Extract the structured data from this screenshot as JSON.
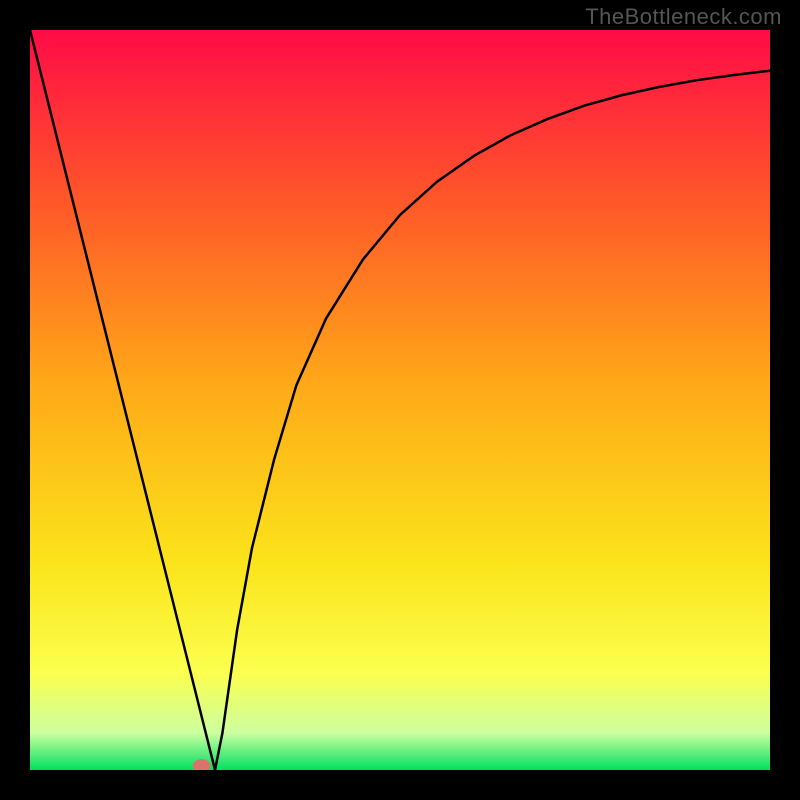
{
  "watermark": "TheBottleneck.com",
  "chart_data": {
    "type": "line",
    "title": "",
    "xlabel": "",
    "ylabel": "",
    "xlim": [
      0,
      100
    ],
    "ylim": [
      0,
      100
    ],
    "grid": false,
    "legend": false,
    "background_gradient": {
      "top": "#ff0b46",
      "q1": "#ff5a28",
      "mid": "#ffa918",
      "q3": "#fbe41a",
      "q4": "#fbff4f",
      "band": "#ccffa0",
      "bottom": "#00e060"
    },
    "series": [
      {
        "name": "bottleneck-curve",
        "x": [
          0,
          4,
          8,
          12,
          16,
          20,
          22,
          23.5,
          25,
          26,
          27,
          28,
          30,
          33,
          36,
          40,
          45,
          50,
          55,
          60,
          65,
          70,
          75,
          80,
          85,
          90,
          95,
          100
        ],
        "values": [
          100,
          84,
          68,
          52,
          36,
          20,
          12,
          6,
          0,
          5,
          12,
          19,
          30,
          42,
          52,
          61,
          69,
          75,
          79.5,
          83,
          85.8,
          88,
          89.8,
          91.2,
          92.3,
          93.2,
          93.9,
          94.5
        ]
      }
    ],
    "marker": {
      "name": "minimum-point",
      "x": 23.2,
      "y": 0.6,
      "color": "#d9746c",
      "size": 9
    }
  }
}
